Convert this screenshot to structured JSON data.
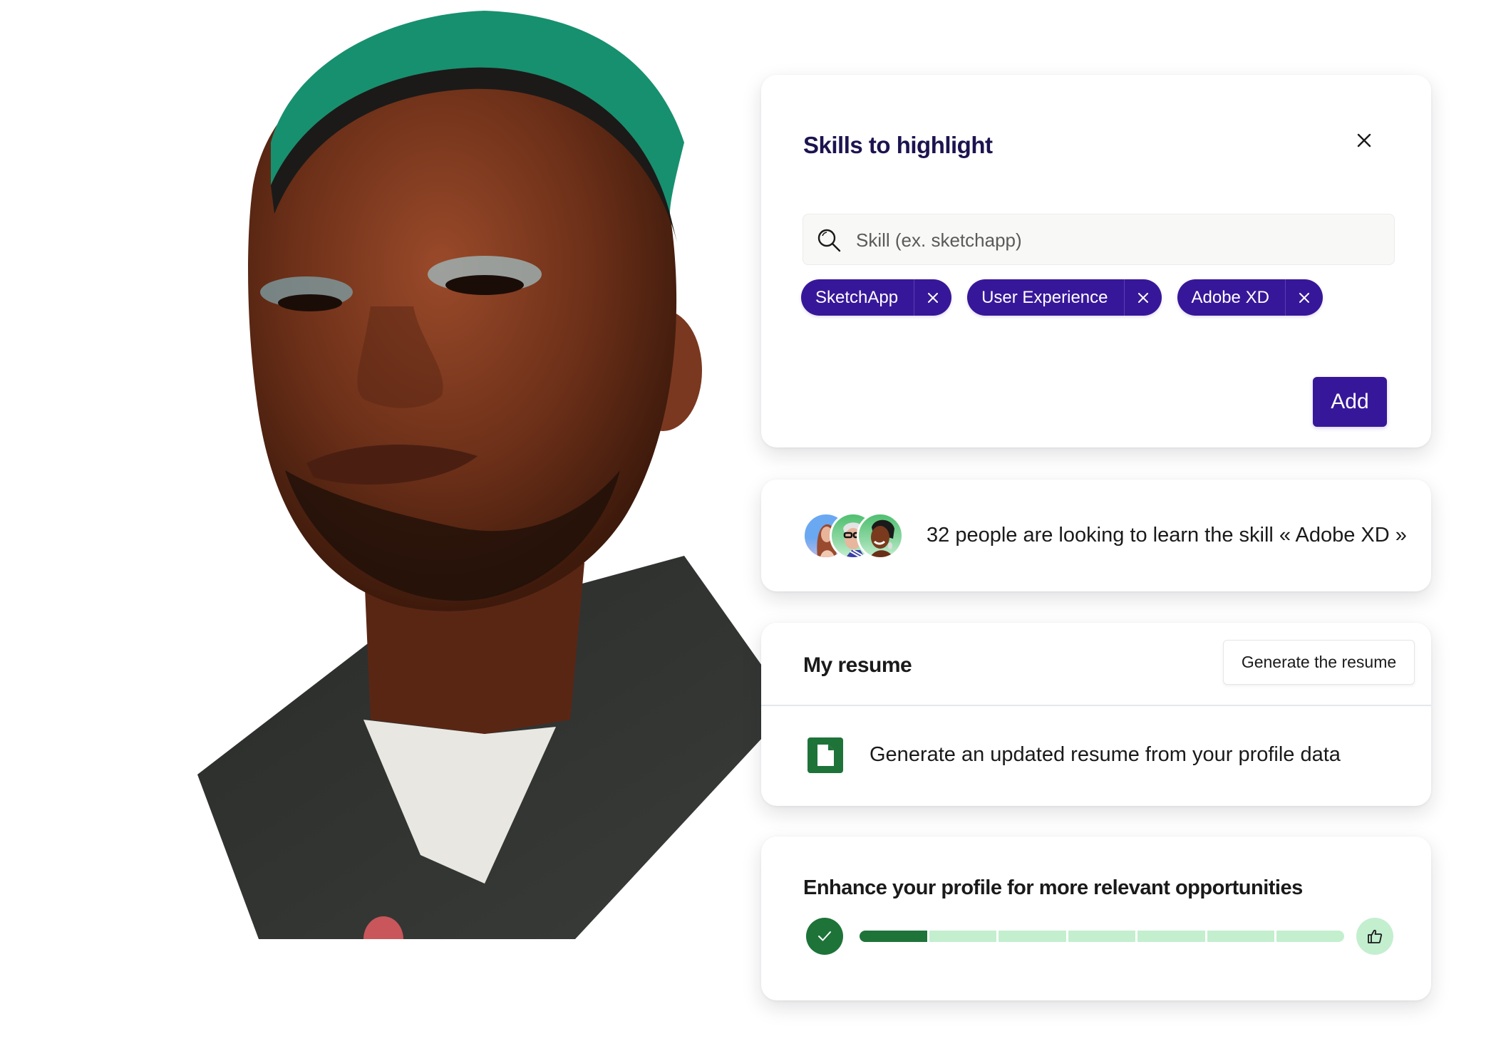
{
  "skills_card": {
    "title": "Skills to highlight",
    "close_icon": "close-icon",
    "search": {
      "icon": "search-icon",
      "placeholder": "Skill (ex. sketchapp)",
      "value": ""
    },
    "tags": [
      {
        "label": "SketchApp",
        "remove_icon": "close-icon"
      },
      {
        "label": "User Experience",
        "remove_icon": "close-icon"
      },
      {
        "label": "Adobe XD",
        "remove_icon": "close-icon"
      }
    ],
    "add_label": "Add"
  },
  "learn_card": {
    "avatars": [
      "avatar-woman-red-hair",
      "avatar-man-glasses",
      "avatar-woman-headwrap"
    ],
    "text": "32 people are looking to learn the skill « Adobe XD »"
  },
  "resume_card": {
    "title": "My resume",
    "generate_label": "Generate the resume",
    "icon": "document-icon",
    "description": "Generate an updated resume from your profile data"
  },
  "profile_card": {
    "title": "Enhance your profile for more relevant opportunities",
    "start_icon": "check-icon",
    "end_icon": "thumbs-up-icon",
    "progress": {
      "completed_steps": 1,
      "total_steps": 7
    }
  },
  "colors": {
    "primary": "#371799",
    "title": "#1c1450",
    "success": "#1e7339",
    "success_light": "#c3efcf"
  }
}
